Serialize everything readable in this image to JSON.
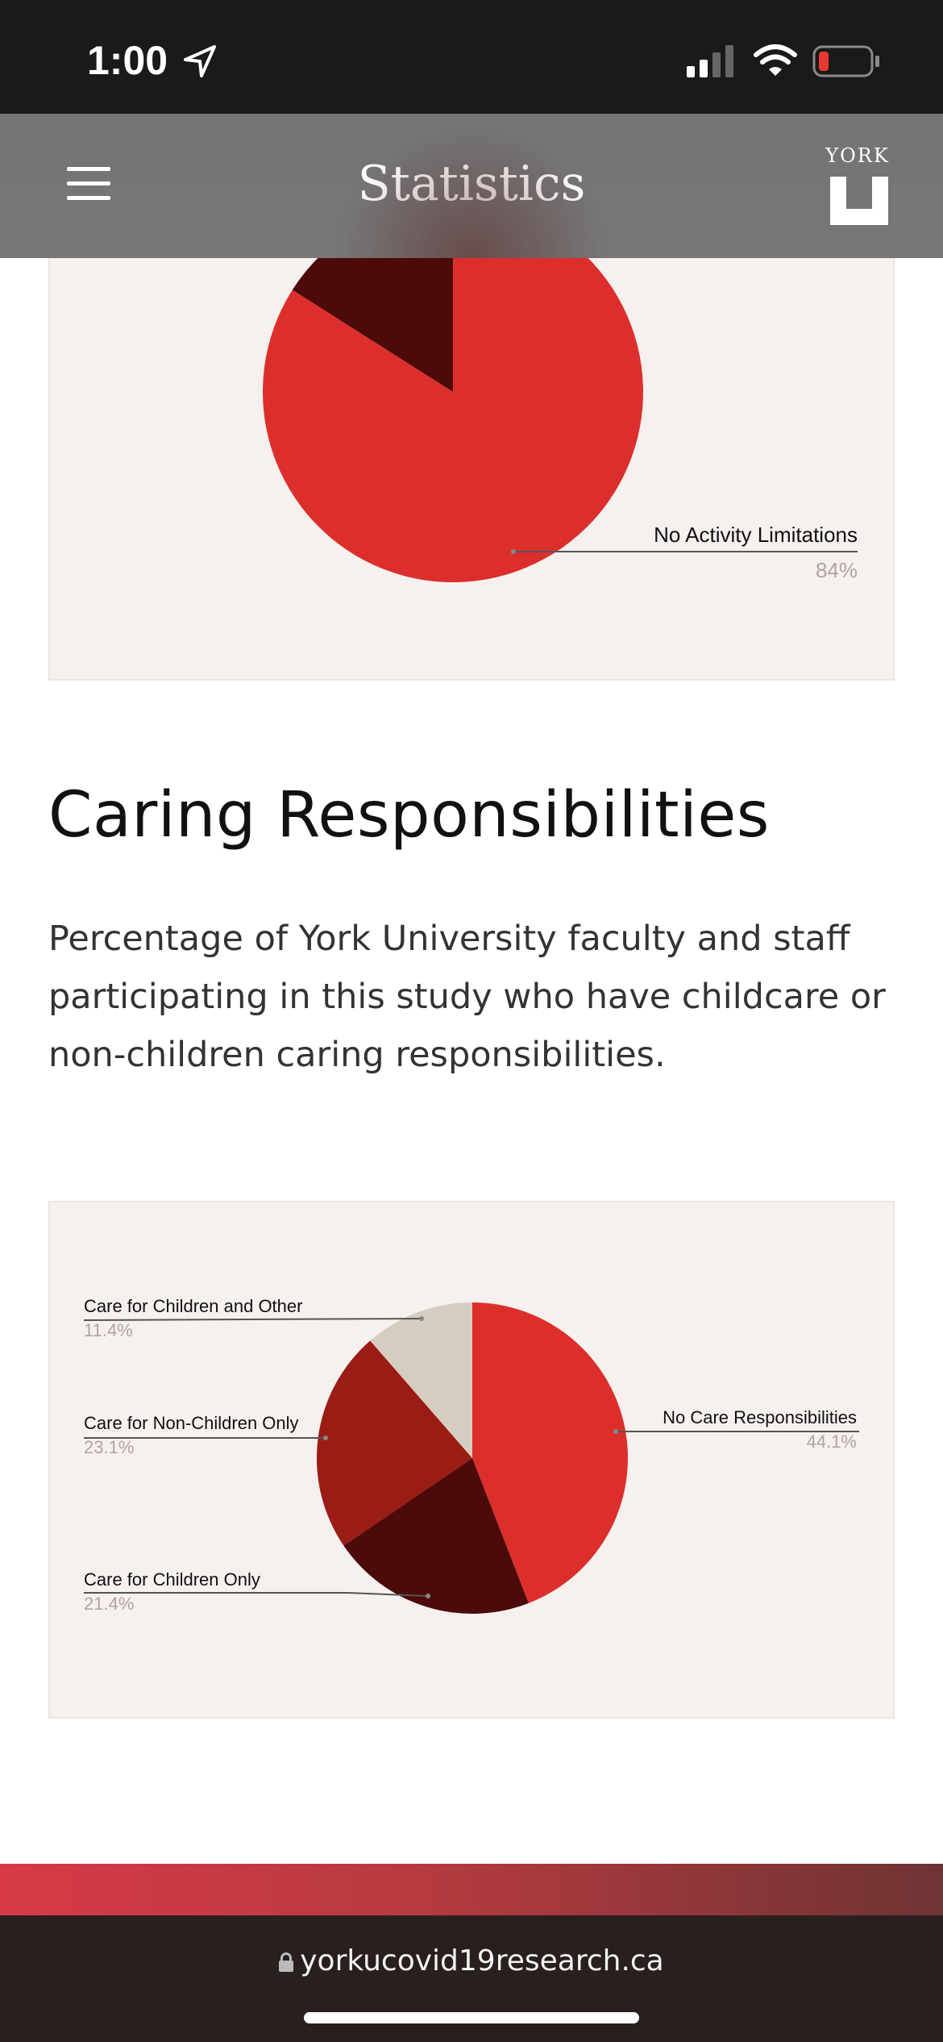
{
  "status_bar": {
    "time": "1:00"
  },
  "header": {
    "title": "Statistics",
    "logo_text": "YORK"
  },
  "top_chart": {
    "visible_label": "No Activity Limitations",
    "visible_value": "84%"
  },
  "section": {
    "title": "Caring Responsibilities",
    "description": "Percentage of York University faculty and staff participating in this study who have childcare or non-children caring responsibilities."
  },
  "chart_data": [
    {
      "type": "pie",
      "series": [
        {
          "label": "No Activity Limitations",
          "value": 84,
          "color": "#dc2f2c"
        },
        {
          "label": "",
          "value": 16,
          "color": "#4d0a0a"
        }
      ]
    },
    {
      "type": "pie",
      "series": [
        {
          "label": "No Care Responsibilities",
          "value": 44.1,
          "color": "#dc2f2c"
        },
        {
          "label": "Care for Children Only",
          "value": 21.4,
          "color": "#4d0a0a"
        },
        {
          "label": "Care for Non-Children Only",
          "value": 23.1,
          "color": "#9b1c14"
        },
        {
          "label": "Care for Children and Other",
          "value": 11.4,
          "color": "#d6cdc1"
        }
      ]
    }
  ],
  "care_chart": {
    "labels": {
      "no_care": "No Care Responsibilities",
      "no_care_pct": "44.1%",
      "children_only": "Care for Children Only",
      "children_only_pct": "21.4%",
      "non_children": "Care for Non-Children Only",
      "non_children_pct": "23.1%",
      "children_other": "Care for Children and Other",
      "children_other_pct": "11.4%"
    }
  },
  "browser": {
    "url": "yorkucovid19research.ca"
  }
}
